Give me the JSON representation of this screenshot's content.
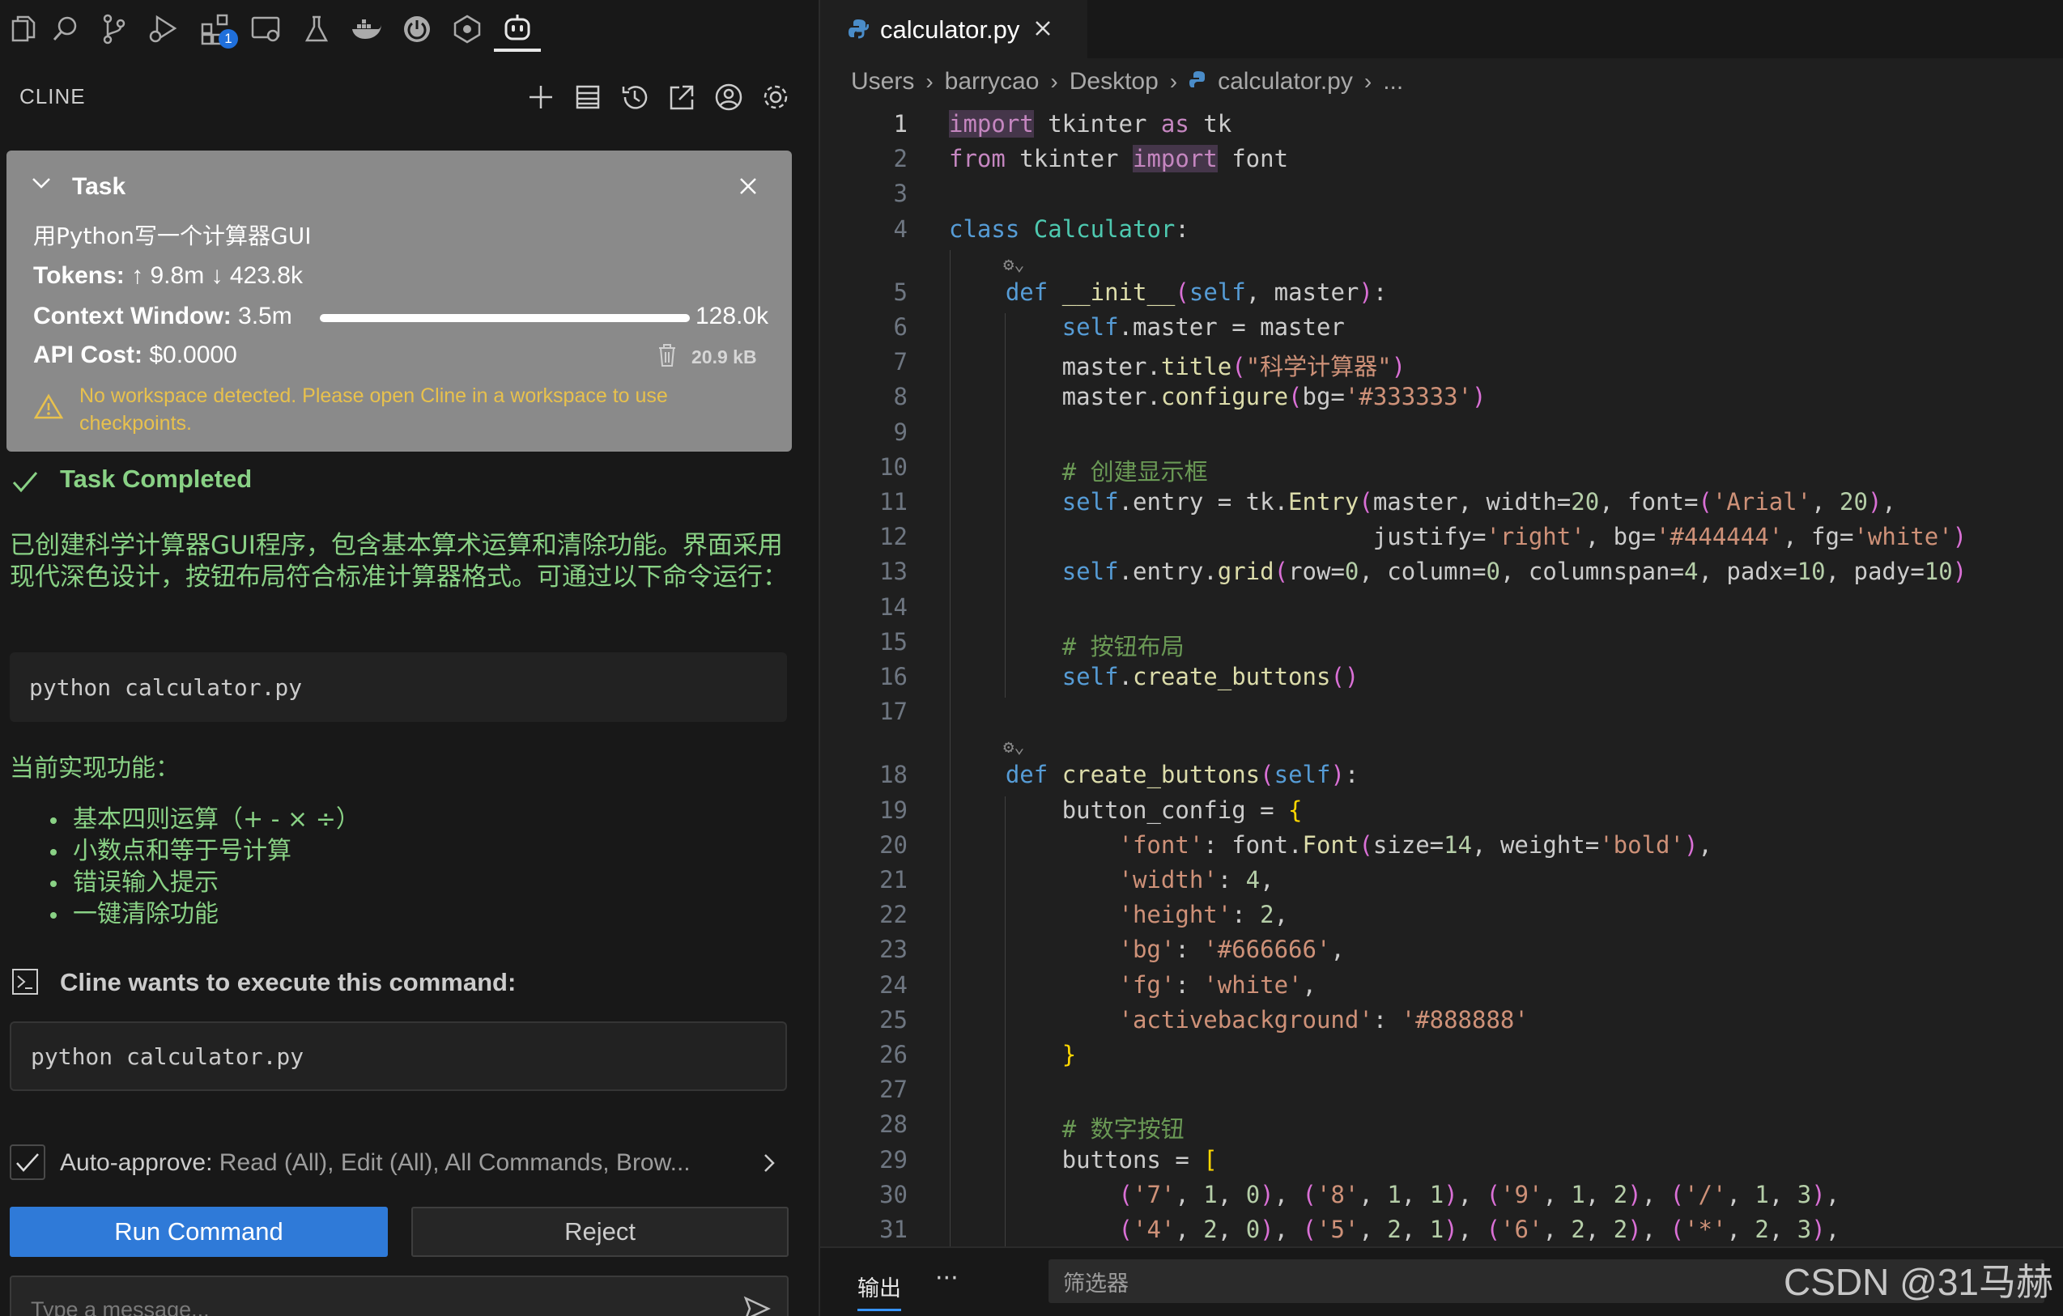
{
  "sidebar": {
    "panel_title": "CLINE",
    "activity_icons": [
      "explorer-icon",
      "search-icon",
      "source-control-icon",
      "run-debug-icon",
      "extensions-icon",
      "remote-explorer-icon",
      "testing-icon",
      "docker-icon",
      "power-icon",
      "graph-icon",
      "cline-robot-icon"
    ],
    "extensions_badge": "1",
    "header_icons": [
      "plus-icon",
      "mcp-servers-icon",
      "history-icon",
      "open-external-icon",
      "account-icon",
      "settings-icon"
    ]
  },
  "task": {
    "header": "Task",
    "prompt": "用Python写一个计算器GUI",
    "tokens_label": "Tokens:",
    "tokens_up": "9.8m",
    "tokens_down": "423.8k",
    "context_label": "Context Window:",
    "context_used": "3.5m",
    "context_max": "128.0k",
    "context_fill": 1.0,
    "cost_label": "API Cost:",
    "cost_value": "$0.0000",
    "size": "20.9 kB",
    "warning": "No workspace detected. Please open Cline in a workspace to use checkpoints."
  },
  "chat": {
    "completed": "Task Completed",
    "description": "已创建科学计算器GUI程序，包含基本算术运算和清除功能。界面采用现代深色设计，按钮布局符合标准计算器格式。可通过以下命令运行：",
    "command_block": "python calculator.py",
    "features_title": "当前实现功能：",
    "features": [
      "基本四则运算（+ - × ÷）",
      "小数点和等于号计算",
      "错误输入提示",
      "一键清除功能"
    ],
    "command_request": "Cline wants to execute this command:",
    "command": "python calculator.py",
    "auto_approve_label": "Auto-approve:",
    "auto_approve_value": "Read (All), Edit (All), All Commands, Brow...",
    "run_button": "Run Command",
    "reject_button": "Reject",
    "message_placeholder": "Type a message..."
  },
  "editor": {
    "tab_title": "calculator.py",
    "breadcrumb": [
      "Users",
      "barrycao",
      "Desktop",
      "calculator.py",
      "..."
    ],
    "current_line": 1,
    "line_numbers": [
      "1",
      "2",
      "3",
      "4",
      "5",
      "6",
      "7",
      "8",
      "9",
      "10",
      "11",
      "12",
      "13",
      "14",
      "15",
      "16",
      "17",
      "18",
      "19",
      "20",
      "21",
      "22",
      "23",
      "24",
      "25",
      "26",
      "27",
      "28",
      "29",
      "30",
      "31"
    ],
    "code_lines": [
      "import tkinter as tk",
      "from tkinter import font",
      "",
      "class Calculator:",
      "    def __init__(self, master):",
      "        self.master = master",
      "        master.title(\"科学计算器\")",
      "        master.configure(bg='#333333')",
      "",
      "        # 创建显示框",
      "        self.entry = tk.Entry(master, width=20, font=('Arial', 20),",
      "                              justify='right', bg='#444444', fg='white')",
      "        self.entry.grid(row=0, column=0, columnspan=4, padx=10, pady=10)",
      "",
      "        # 按钮布局",
      "        self.create_buttons()",
      "",
      "    def create_buttons(self):",
      "        button_config = {",
      "            'font': font.Font(size=14, weight='bold'),",
      "            'width': 4,",
      "            'height': 2,",
      "            'bg': '#666666',",
      "            'fg': 'white',",
      "            'activebackground': '#888888'",
      "        }",
      "",
      "        # 数字按钮",
      "        buttons = [",
      "            ('7', 1, 0), ('8', 1, 1), ('9', 1, 2), ('/', 1, 3),",
      "            ('4', 2, 0), ('5', 2, 1), ('6', 2, 2), ('*', 2, 3),"
    ]
  },
  "panel": {
    "output_tab": "输出",
    "more": "···",
    "filter_placeholder": "筛选器"
  },
  "watermark": "CSDN @31马赫",
  "colors": {
    "accent": "#2f7ad8",
    "success": "#89d185",
    "warning": "#e8c14d",
    "task_bg": "#8a8a8a"
  }
}
